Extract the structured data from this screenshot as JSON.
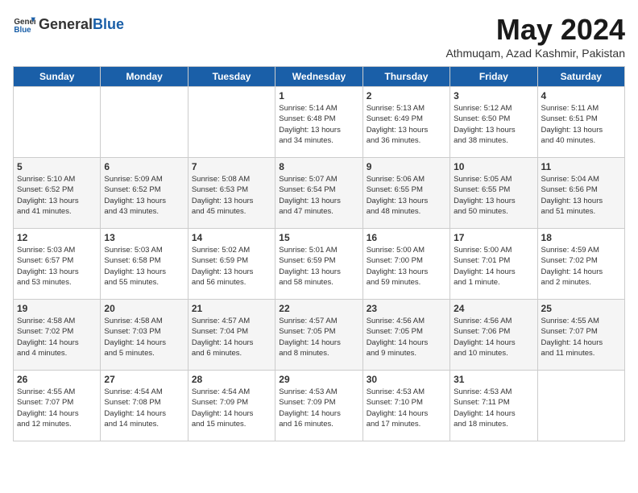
{
  "header": {
    "logo_general": "General",
    "logo_blue": "Blue",
    "title": "May 2024",
    "subtitle": "Athmuqam, Azad Kashmir, Pakistan"
  },
  "days": [
    "Sunday",
    "Monday",
    "Tuesday",
    "Wednesday",
    "Thursday",
    "Friday",
    "Saturday"
  ],
  "weeks": [
    [
      {
        "date": "",
        "info": ""
      },
      {
        "date": "",
        "info": ""
      },
      {
        "date": "",
        "info": ""
      },
      {
        "date": "1",
        "info": "Sunrise: 5:14 AM\nSunset: 6:48 PM\nDaylight: 13 hours\nand 34 minutes."
      },
      {
        "date": "2",
        "info": "Sunrise: 5:13 AM\nSunset: 6:49 PM\nDaylight: 13 hours\nand 36 minutes."
      },
      {
        "date": "3",
        "info": "Sunrise: 5:12 AM\nSunset: 6:50 PM\nDaylight: 13 hours\nand 38 minutes."
      },
      {
        "date": "4",
        "info": "Sunrise: 5:11 AM\nSunset: 6:51 PM\nDaylight: 13 hours\nand 40 minutes."
      }
    ],
    [
      {
        "date": "5",
        "info": "Sunrise: 5:10 AM\nSunset: 6:52 PM\nDaylight: 13 hours\nand 41 minutes."
      },
      {
        "date": "6",
        "info": "Sunrise: 5:09 AM\nSunset: 6:52 PM\nDaylight: 13 hours\nand 43 minutes."
      },
      {
        "date": "7",
        "info": "Sunrise: 5:08 AM\nSunset: 6:53 PM\nDaylight: 13 hours\nand 45 minutes."
      },
      {
        "date": "8",
        "info": "Sunrise: 5:07 AM\nSunset: 6:54 PM\nDaylight: 13 hours\nand 47 minutes."
      },
      {
        "date": "9",
        "info": "Sunrise: 5:06 AM\nSunset: 6:55 PM\nDaylight: 13 hours\nand 48 minutes."
      },
      {
        "date": "10",
        "info": "Sunrise: 5:05 AM\nSunset: 6:55 PM\nDaylight: 13 hours\nand 50 minutes."
      },
      {
        "date": "11",
        "info": "Sunrise: 5:04 AM\nSunset: 6:56 PM\nDaylight: 13 hours\nand 51 minutes."
      }
    ],
    [
      {
        "date": "12",
        "info": "Sunrise: 5:03 AM\nSunset: 6:57 PM\nDaylight: 13 hours\nand 53 minutes."
      },
      {
        "date": "13",
        "info": "Sunrise: 5:03 AM\nSunset: 6:58 PM\nDaylight: 13 hours\nand 55 minutes."
      },
      {
        "date": "14",
        "info": "Sunrise: 5:02 AM\nSunset: 6:59 PM\nDaylight: 13 hours\nand 56 minutes."
      },
      {
        "date": "15",
        "info": "Sunrise: 5:01 AM\nSunset: 6:59 PM\nDaylight: 13 hours\nand 58 minutes."
      },
      {
        "date": "16",
        "info": "Sunrise: 5:00 AM\nSunset: 7:00 PM\nDaylight: 13 hours\nand 59 minutes."
      },
      {
        "date": "17",
        "info": "Sunrise: 5:00 AM\nSunset: 7:01 PM\nDaylight: 14 hours\nand 1 minute."
      },
      {
        "date": "18",
        "info": "Sunrise: 4:59 AM\nSunset: 7:02 PM\nDaylight: 14 hours\nand 2 minutes."
      }
    ],
    [
      {
        "date": "19",
        "info": "Sunrise: 4:58 AM\nSunset: 7:02 PM\nDaylight: 14 hours\nand 4 minutes."
      },
      {
        "date": "20",
        "info": "Sunrise: 4:58 AM\nSunset: 7:03 PM\nDaylight: 14 hours\nand 5 minutes."
      },
      {
        "date": "21",
        "info": "Sunrise: 4:57 AM\nSunset: 7:04 PM\nDaylight: 14 hours\nand 6 minutes."
      },
      {
        "date": "22",
        "info": "Sunrise: 4:57 AM\nSunset: 7:05 PM\nDaylight: 14 hours\nand 8 minutes."
      },
      {
        "date": "23",
        "info": "Sunrise: 4:56 AM\nSunset: 7:05 PM\nDaylight: 14 hours\nand 9 minutes."
      },
      {
        "date": "24",
        "info": "Sunrise: 4:56 AM\nSunset: 7:06 PM\nDaylight: 14 hours\nand 10 minutes."
      },
      {
        "date": "25",
        "info": "Sunrise: 4:55 AM\nSunset: 7:07 PM\nDaylight: 14 hours\nand 11 minutes."
      }
    ],
    [
      {
        "date": "26",
        "info": "Sunrise: 4:55 AM\nSunset: 7:07 PM\nDaylight: 14 hours\nand 12 minutes."
      },
      {
        "date": "27",
        "info": "Sunrise: 4:54 AM\nSunset: 7:08 PM\nDaylight: 14 hours\nand 14 minutes."
      },
      {
        "date": "28",
        "info": "Sunrise: 4:54 AM\nSunset: 7:09 PM\nDaylight: 14 hours\nand 15 minutes."
      },
      {
        "date": "29",
        "info": "Sunrise: 4:53 AM\nSunset: 7:09 PM\nDaylight: 14 hours\nand 16 minutes."
      },
      {
        "date": "30",
        "info": "Sunrise: 4:53 AM\nSunset: 7:10 PM\nDaylight: 14 hours\nand 17 minutes."
      },
      {
        "date": "31",
        "info": "Sunrise: 4:53 AM\nSunset: 7:11 PM\nDaylight: 14 hours\nand 18 minutes."
      },
      {
        "date": "",
        "info": ""
      }
    ]
  ]
}
